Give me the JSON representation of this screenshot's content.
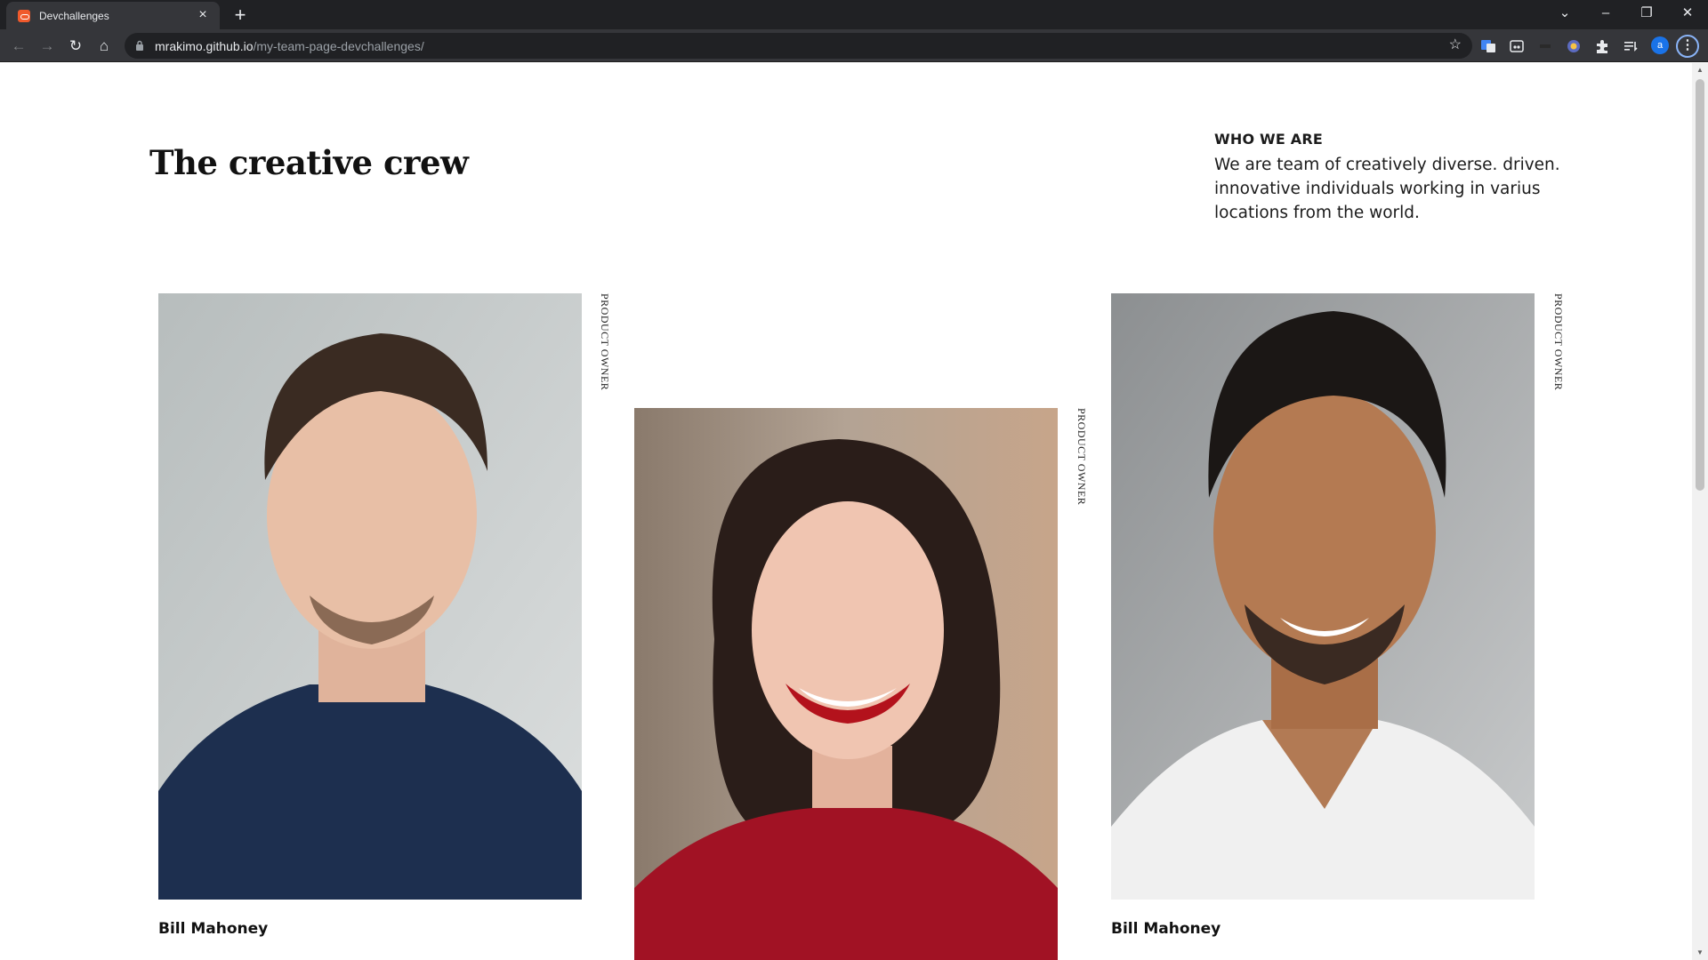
{
  "browser": {
    "tab_title": "Devchallenges",
    "url_domain": "mrakimo.github.io",
    "url_path": "/my-team-page-devchallenges/",
    "profile_initial": "a"
  },
  "page": {
    "heading": "The creative crew",
    "who_title": "WHO WE ARE",
    "who_text": "We are team of creatively diverse. driven. innovative individuals working in varius locations from the world."
  },
  "members": [
    {
      "name": "Bill Mahoney",
      "role": "PRODUCT OWNER"
    },
    {
      "name": "",
      "role": "PRODUCT OWNER"
    },
    {
      "name": "Bill Mahoney",
      "role": "PRODUCT OWNER"
    }
  ],
  "colors": {
    "chrome_dark": "#202124",
    "chrome_tab": "#35363a",
    "accent": "#8ab4f8",
    "favicon": "#f05a2c"
  }
}
